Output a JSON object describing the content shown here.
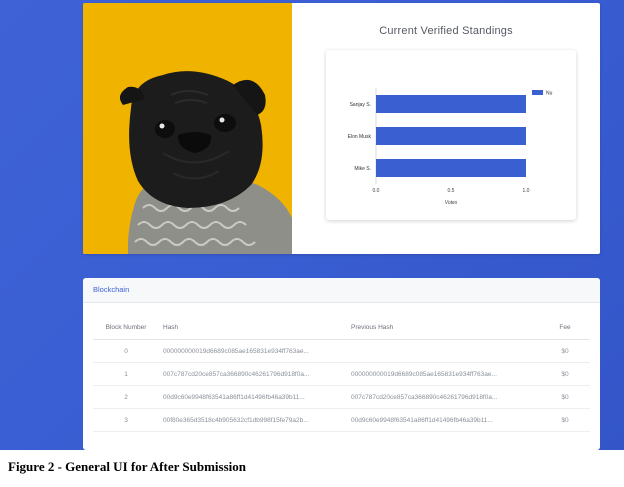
{
  "standings": {
    "title": "Current Verified Standings"
  },
  "chart_data": {
    "type": "bar",
    "orientation": "horizontal",
    "categories": [
      "Sanjay S.",
      "Elon Musk",
      "Mike S."
    ],
    "series": [
      {
        "name": "Nu",
        "values": [
          1,
          1,
          1
        ]
      }
    ],
    "xlabel": "Votes",
    "ylabel": "",
    "xlim": [
      0,
      1
    ],
    "xticks": [
      "0.0",
      "0.5",
      "1.0"
    ],
    "legend": "top-right",
    "bar_color": "#3a5fd0"
  },
  "blockchain": {
    "title": "Blockchain",
    "columns": [
      "Block Number",
      "Hash",
      "Previous Hash",
      "Fee"
    ],
    "rows": [
      {
        "num": "0",
        "hash": "000000000019d6689c085ae165831e934ff763ae...",
        "prev": "",
        "fee": "$0"
      },
      {
        "num": "1",
        "hash": "007c787cd20ce857ca366890c46261796d918f0a...",
        "prev": "000000000019d6689c085ae165831e934ff763ae...",
        "fee": "$0"
      },
      {
        "num": "2",
        "hash": "00d9c60e9948f63541a86ff1d41496fb46a39b11...",
        "prev": "007c787cd20ce857ca366890c46261796d918f0a...",
        "fee": "$0"
      },
      {
        "num": "3",
        "hash": "00f80e365d3518c4b905632cf1db998f15fe79a2b...",
        "prev": "00d9c60e9948f63541a86ff1d41496fb46a39b11...",
        "fee": "$0"
      }
    ]
  },
  "caption": "Figure 2 - General UI for After Submission",
  "colors": {
    "background": "#3f63d6",
    "photo_background": "#f0b400",
    "accent": "#3f63d6"
  }
}
